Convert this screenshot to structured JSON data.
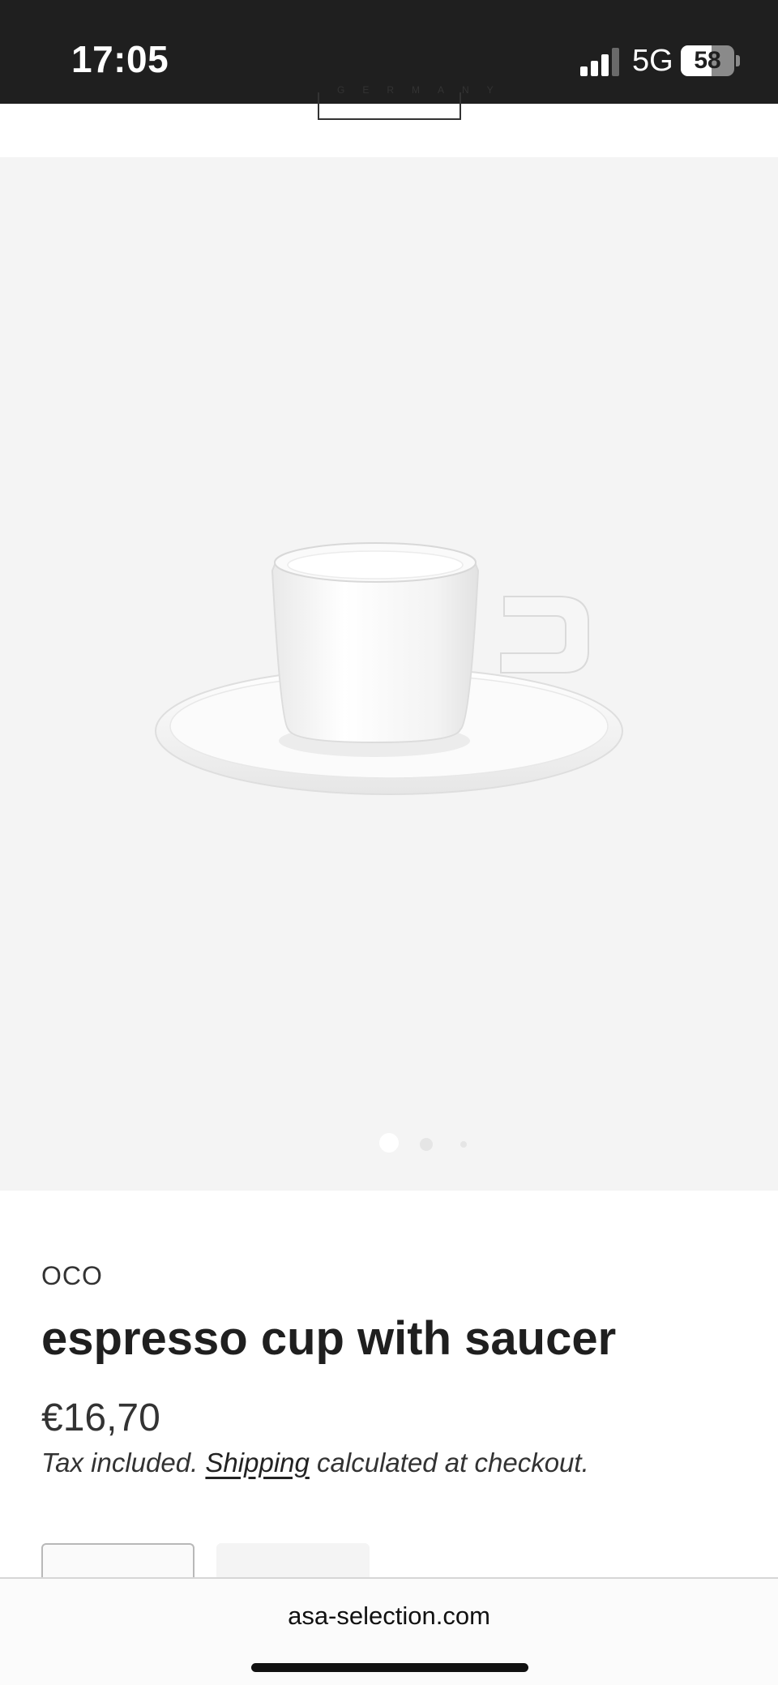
{
  "status_bar": {
    "time": "17:05",
    "network": "5G",
    "battery": "58",
    "signal_icon": "signal-bars-icon",
    "battery_icon": "battery-icon"
  },
  "header": {
    "logo_subtext": "GERMANY"
  },
  "gallery": {
    "image_alt": "espresso cup with saucer",
    "slide_count": 3,
    "active_slide": 1,
    "background": "#f4f4f4"
  },
  "product": {
    "brand": "oco",
    "title": "espresso cup with saucer",
    "price": "€16,70",
    "tax_prefix": "Tax included.",
    "shipping_link": "Shipping",
    "tax_suffix": "calculated at checkout."
  },
  "browser": {
    "url": "asa-selection.com"
  },
  "colors": {
    "status_bar_bg": "#1f1f1f",
    "text": "#1f1f1f",
    "gallery_bg": "#f4f4f4"
  }
}
